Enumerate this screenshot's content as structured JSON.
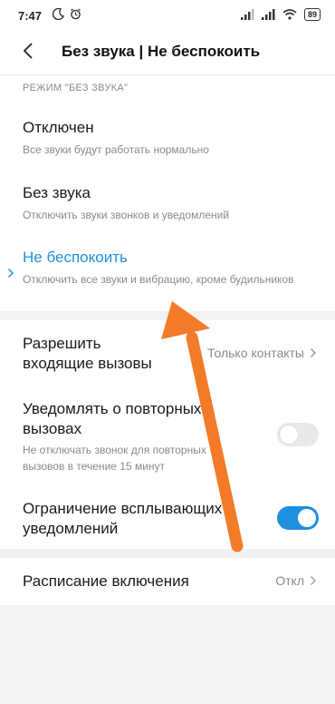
{
  "status_bar": {
    "time": "7:47",
    "battery": "89"
  },
  "header": {
    "title": "Без звука | Не беспокоить"
  },
  "mode_section": {
    "label": "РЕЖИМ \"БЕЗ ЗВУКА\"",
    "options": [
      {
        "title": "Отключен",
        "subtitle": "Все звуки будут работать нормально"
      },
      {
        "title": "Без звука",
        "subtitle": "Отключить звуки звонков и уведомлений"
      },
      {
        "title": "Не беспокоить",
        "subtitle": "Отключить все звуки и вибрацию, кроме будильников",
        "selected": true
      }
    ]
  },
  "settings": {
    "allow_calls": {
      "title_line1": "Разрешить",
      "title_line2": "входящие вызовы",
      "value": "Только контакты"
    },
    "repeat_calls": {
      "title_line1": "Уведомлять о повторных",
      "title_line2": "вызовах",
      "subtitle_line1": "Не отключать звонок для повторных",
      "subtitle_line2": "вызовов в течение 15 минут",
      "enabled": false
    },
    "limit_popups": {
      "title_line1": "Ограничение всплывающих",
      "title_line2": "уведомлений",
      "enabled": true
    }
  },
  "schedule": {
    "title": "Расписание включения",
    "value": "Откл"
  },
  "colors": {
    "accent": "#1f8fe0",
    "annotation_arrow": "#f27a28",
    "background": "#f2f2f2"
  },
  "icons": [
    "moon-icon",
    "alarm-icon",
    "signal-icon",
    "wifi-icon",
    "battery-icon",
    "back-arrow-icon",
    "chevron-right-icon"
  ]
}
